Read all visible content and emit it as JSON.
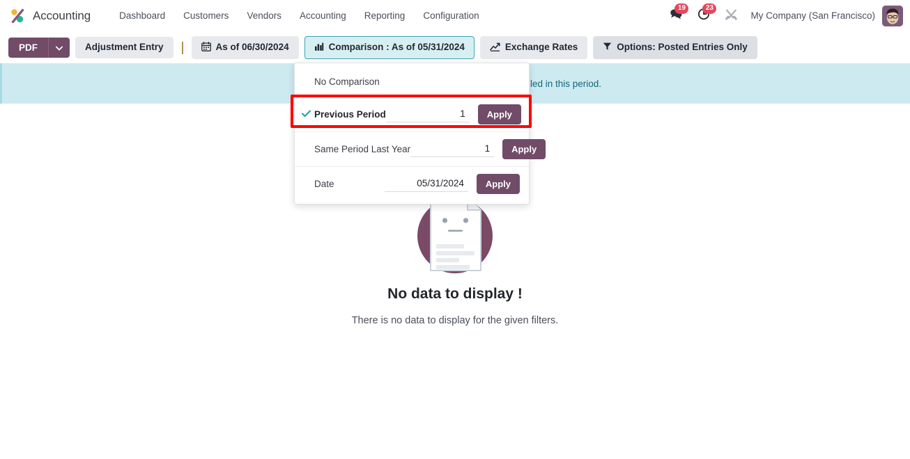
{
  "navbar": {
    "logo_icon": "odoo-logo-icon",
    "brand": "Accounting",
    "menu": [
      {
        "label": "Dashboard"
      },
      {
        "label": "Customers"
      },
      {
        "label": "Vendors"
      },
      {
        "label": "Accounting"
      },
      {
        "label": "Reporting"
      },
      {
        "label": "Configuration"
      }
    ],
    "messages": {
      "icon": "messages-icon",
      "count": "19"
    },
    "activities": {
      "icon": "activity-clock-icon",
      "count": "23"
    },
    "debug": {
      "icon": "wrench-tools-icon"
    },
    "company": "My Company (San Francisco)",
    "avatar_icon": "user-avatar"
  },
  "controlbar": {
    "pdf_label": "PDF",
    "pdf_caret_icon": "caret-down-icon",
    "adjustment_entry_label": "Adjustment Entry",
    "date_filter": {
      "icon": "calendar-icon",
      "label": "As of 06/30/2024"
    },
    "comparison_filter": {
      "icon": "bar-chart-icon",
      "label": "Comparison : As of 05/31/2024",
      "active": true
    },
    "exchange_rates": {
      "icon": "line-chart-icon",
      "label": "Exchange Rates"
    },
    "options_filter": {
      "icon": "funnel-icon",
      "label": "Options: Posted Entries Only"
    }
  },
  "banner": {
    "text": "led in this period."
  },
  "comparison_dropdown": {
    "no_comparison_label": "No Comparison",
    "rows": [
      {
        "label": "Previous Period",
        "selected": true,
        "check_icon": "check-icon",
        "value": "1",
        "apply_label": "Apply"
      },
      {
        "label": "Same Period Last Year",
        "selected": false,
        "value": "1",
        "apply_label": "Apply"
      },
      {
        "label": "Date",
        "selected": false,
        "value": "05/31/2024",
        "apply_label": "Apply"
      }
    ]
  },
  "empty_state": {
    "illustration_icon": "no-data-document-icon",
    "title": "No data to display !",
    "subtitle": "There is no data to display for the given filters."
  },
  "colors": {
    "brand_purple": "#714b67",
    "accent_teal": "#00a09d",
    "badge_red": "#e4485d",
    "highlight_red": "#fe0000",
    "banner_bg": "#cdeaf1",
    "banner_text": "#17667a",
    "active_filter_bg": "#d8eff2",
    "active_filter_border": "#3aa5b3"
  }
}
